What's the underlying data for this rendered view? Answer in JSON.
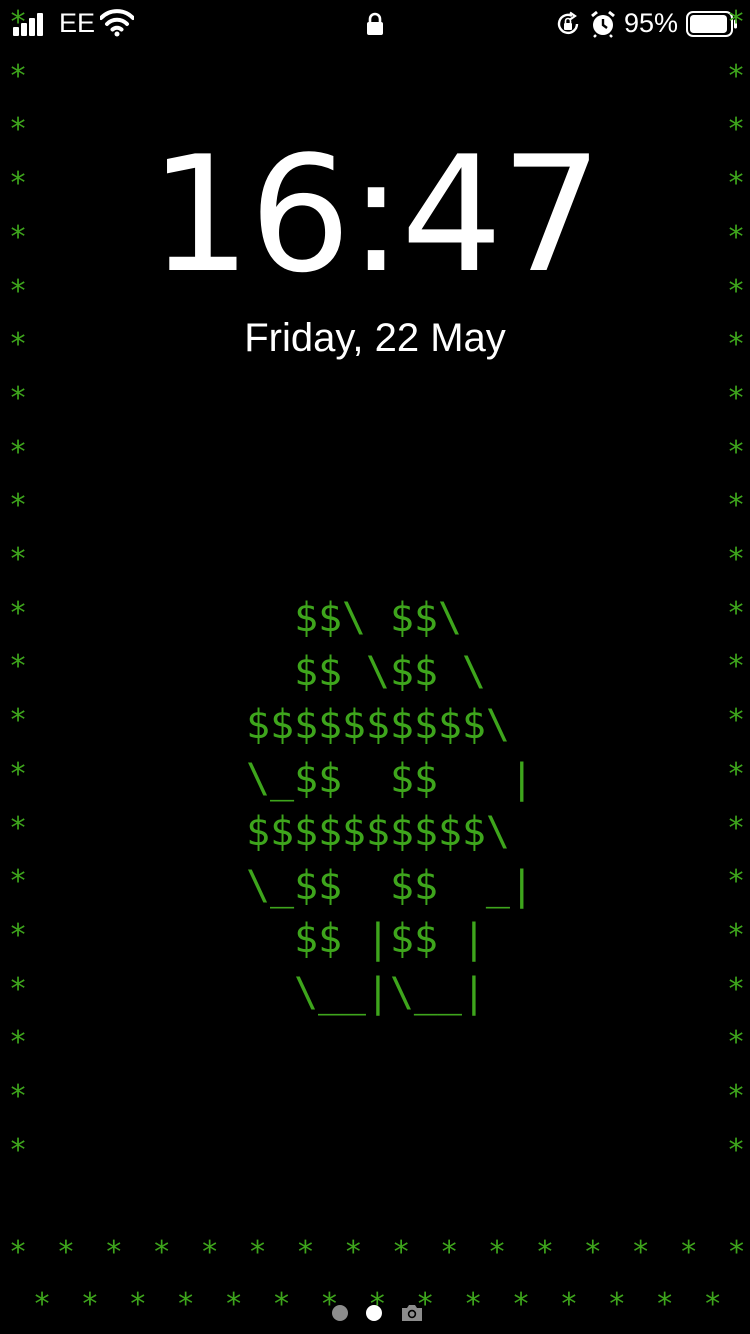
{
  "status_bar": {
    "carrier": "EE",
    "battery_percent": "95%",
    "battery_level": 0.95,
    "icons": [
      "signal-icon",
      "wifi-icon",
      "lock-icon",
      "orientation-lock-icon",
      "alarm-icon",
      "battery-icon"
    ]
  },
  "lock_screen": {
    "time": "16:47",
    "date": "Friday, 22 May"
  },
  "wallpaper": {
    "accent_color": "#3ea51c",
    "border_char": "*",
    "ascii_art": [
      "  $$\\ $$\\",
      "  $$ \\$$ \\",
      "$$$$$$$$$$\\",
      "\\_$$  $$   |",
      "$$$$$$$$$$\\",
      "\\_$$  $$  _|",
      "  $$ |$$ |",
      "  \\__|\\__|"
    ]
  },
  "page_indicator": {
    "pages": 3,
    "current_page": 2,
    "icons": [
      "camera-icon"
    ]
  }
}
